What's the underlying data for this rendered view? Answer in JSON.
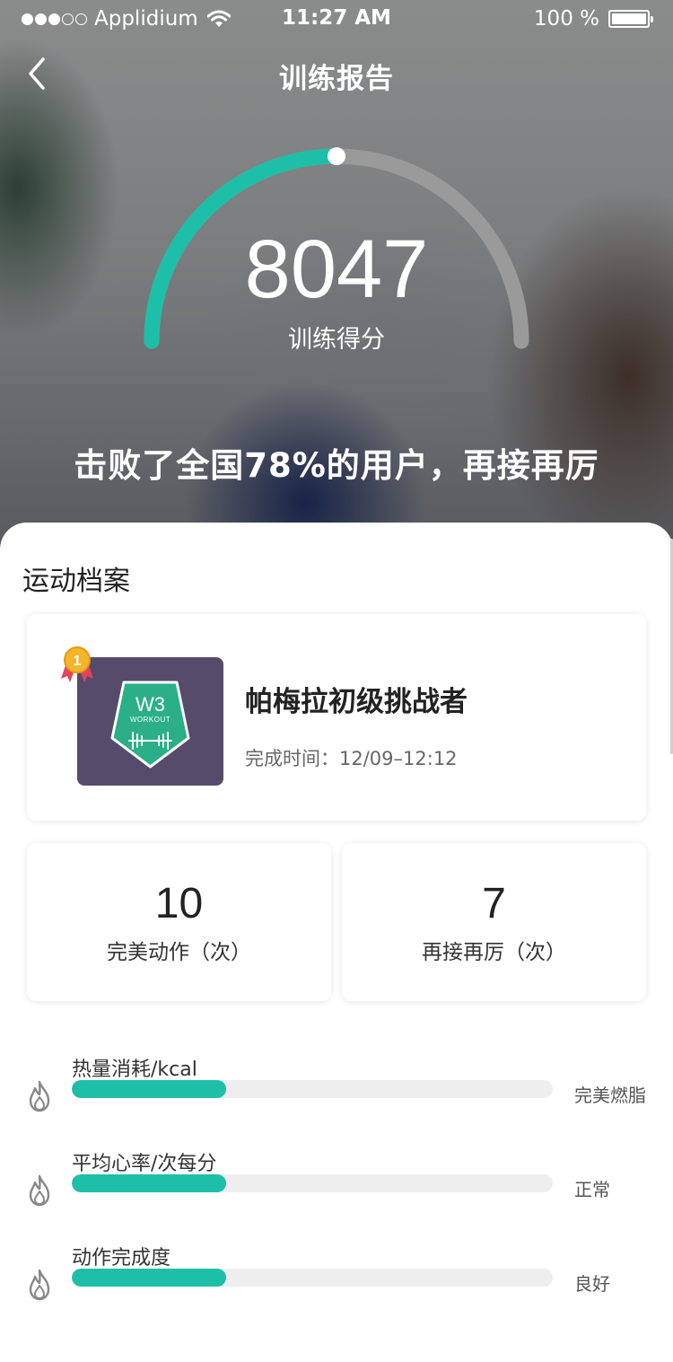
{
  "status_bar": {
    "carrier": "Applidium",
    "time": "11:27 AM",
    "battery": "100 %"
  },
  "header": {
    "title": "训练报告"
  },
  "score": {
    "value": "8047",
    "label": "训练得分",
    "progress_fraction": 0.5
  },
  "rank_message": "击败了全国78%的用户，再接再厉",
  "profile": {
    "section_title": "运动档案",
    "achievement": {
      "medal_number": "1",
      "badge_text": "W3",
      "badge_subtext": "WORKOUT",
      "name": "帕梅拉初级挑战者",
      "completion_time": "完成时间：12/09–12:12"
    },
    "stats": [
      {
        "value": "10",
        "label": "完美动作（次）"
      },
      {
        "value": "7",
        "label": "再接再厉（次）"
      }
    ],
    "metrics": [
      {
        "label": "热量消耗/kcal",
        "status": "完美燃脂",
        "progress": 0.32
      },
      {
        "label": "平均心率/次每分",
        "status": "正常",
        "progress": 0.32
      },
      {
        "label": "动作完成度",
        "status": "良好",
        "progress": 0.32
      }
    ]
  },
  "colors": {
    "accent": "#1ebfa8",
    "track": "#eeeeee",
    "badge_background": "#574b6c",
    "badge_shield": "#2aaf86"
  }
}
